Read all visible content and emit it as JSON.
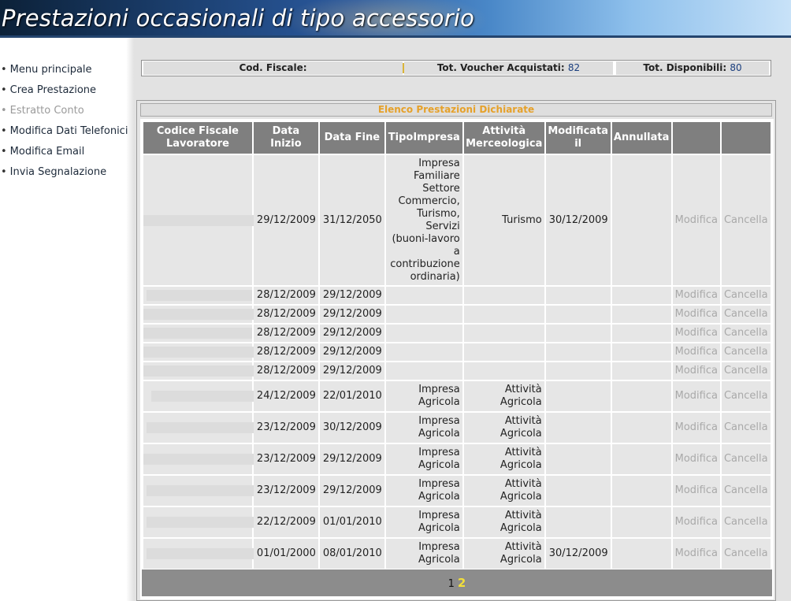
{
  "header": {
    "title": "Prestazioni occasionali di tipo accessorio"
  },
  "nav": {
    "items": [
      {
        "label": "Menu principale",
        "disabled": false
      },
      {
        "label": "Crea Prestazione",
        "disabled": false
      },
      {
        "label": "Estratto Conto",
        "disabled": true
      },
      {
        "label": "Modifica Dati Telefonici",
        "disabled": false
      },
      {
        "label": "Modifica Email",
        "disabled": false
      },
      {
        "label": "Invia Segnalazione",
        "disabled": false
      }
    ]
  },
  "summary": {
    "cf_label": "Cod. Fiscale:",
    "acquired_label": "Tot. Voucher Acquistati:",
    "acquired_value": "82",
    "available_label": "Tot. Disponibili:",
    "available_value": "80"
  },
  "list": {
    "title": "Elenco Prestazioni Dichiarate",
    "columns": [
      "Codice Fiscale Lavoratore",
      "Data Inizio",
      "Data Fine",
      "TipoImpresa",
      "Attività Merceologica",
      "Modificata il",
      "Annullata",
      "",
      ""
    ],
    "action_modify": "Modifica",
    "action_cancel": "Cancella",
    "rows": [
      {
        "start": "29/12/2009",
        "end": "31/12/2050",
        "tipo": "Impresa Familiare Settore Commercio, Turismo, Servizi (buoni-lavoro a contribuzione ordinaria)",
        "attivita": "Turismo",
        "modificata": "30/12/2009",
        "annullata": ""
      },
      {
        "start": "28/12/2009",
        "end": "29/12/2009",
        "tipo": "",
        "attivita": "",
        "modificata": "",
        "annullata": ""
      },
      {
        "start": "28/12/2009",
        "end": "29/12/2009",
        "tipo": "",
        "attivita": "",
        "modificata": "",
        "annullata": ""
      },
      {
        "start": "28/12/2009",
        "end": "29/12/2009",
        "tipo": "",
        "attivita": "",
        "modificata": "",
        "annullata": ""
      },
      {
        "start": "28/12/2009",
        "end": "29/12/2009",
        "tipo": "",
        "attivita": "",
        "modificata": "",
        "annullata": ""
      },
      {
        "start": "28/12/2009",
        "end": "29/12/2009",
        "tipo": "",
        "attivita": "",
        "modificata": "",
        "annullata": ""
      },
      {
        "start": "24/12/2009",
        "end": "22/01/2010",
        "tipo": "Impresa Agricola",
        "attivita": "Attività Agricola",
        "modificata": "",
        "annullata": ""
      },
      {
        "start": "23/12/2009",
        "end": "30/12/2009",
        "tipo": "Impresa Agricola",
        "attivita": "Attività Agricola",
        "modificata": "",
        "annullata": ""
      },
      {
        "start": "23/12/2009",
        "end": "29/12/2009",
        "tipo": "Impresa Agricola",
        "attivita": "Attività Agricola",
        "modificata": "",
        "annullata": ""
      },
      {
        "start": "23/12/2009",
        "end": "29/12/2009",
        "tipo": "Impresa Agricola",
        "attivita": "Attività Agricola",
        "modificata": "",
        "annullata": ""
      },
      {
        "start": "22/12/2009",
        "end": "01/01/2010",
        "tipo": "Impresa Agricola",
        "attivita": "Attività Agricola",
        "modificata": "",
        "annullata": ""
      },
      {
        "start": "01/01/2000",
        "end": "08/01/2010",
        "tipo": "Impresa Agricola",
        "attivita": "Attività Agricola",
        "modificata": "30/12/2009",
        "annullata": ""
      }
    ]
  },
  "pager": {
    "page1": "1",
    "page2": "2",
    "current": "2"
  }
}
